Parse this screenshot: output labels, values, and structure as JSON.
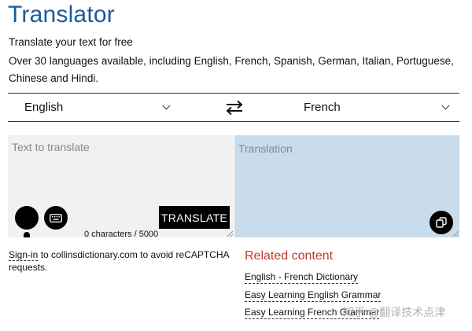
{
  "header": {
    "title": "Translator",
    "subtitle": "Translate your text for free",
    "description": "Over 30 languages available, including English, French, Spanish, German, Italian, Portuguese, Chinese and Hindi."
  },
  "languages": {
    "source": "English",
    "target": "French"
  },
  "source_panel": {
    "placeholder": "Text to translate",
    "translate_label": "TRANSLATE",
    "counter": "0 characters / 5000"
  },
  "target_panel": {
    "placeholder": "Translation"
  },
  "signin": {
    "link": "Sign-in",
    "text": " to collinsdictionary.com to avoid reCAPTCHA requests."
  },
  "related": {
    "title": "Related content",
    "links": [
      "English - French Dictionary",
      "Easy Learning English Grammar",
      "Easy Learning French Grammar"
    ]
  },
  "watermark": "知乎 @翻译技术点津",
  "colors": {
    "title": "#1a5a9a",
    "target_bg": "#c9dcec",
    "related_title": "#c0392b"
  }
}
